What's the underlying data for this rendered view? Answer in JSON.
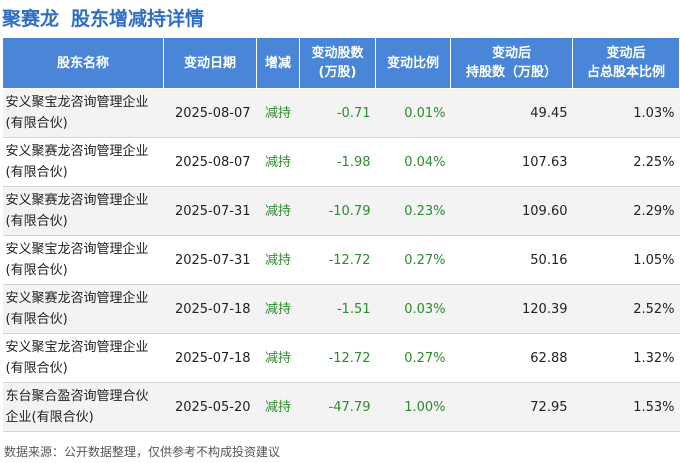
{
  "header": {
    "company": "聚赛龙",
    "title": "股东增减持详情"
  },
  "table": {
    "columns": [
      "股东名称",
      "变动日期",
      "增减",
      "变动股数\n(万股)",
      "变动比例",
      "变动后\n持股数（万股）",
      "变动后\n占总股本比例"
    ],
    "rows": [
      {
        "name": "安义聚宝龙咨询管理企业(有限合伙)",
        "date": "2025-08-07",
        "dir": "减持",
        "change": "-0.71",
        "ratio": "0.01%",
        "after": "49.45",
        "pct": "1.03%"
      },
      {
        "name": "安义聚赛龙咨询管理企业(有限合伙)",
        "date": "2025-08-07",
        "dir": "减持",
        "change": "-1.98",
        "ratio": "0.04%",
        "after": "107.63",
        "pct": "2.25%"
      },
      {
        "name": "安义聚赛龙咨询管理企业(有限合伙)",
        "date": "2025-07-31",
        "dir": "减持",
        "change": "-10.79",
        "ratio": "0.23%",
        "after": "109.60",
        "pct": "2.29%"
      },
      {
        "name": "安义聚宝龙咨询管理企业(有限合伙)",
        "date": "2025-07-31",
        "dir": "减持",
        "change": "-12.72",
        "ratio": "0.27%",
        "after": "50.16",
        "pct": "1.05%"
      },
      {
        "name": "安义聚赛龙咨询管理企业(有限合伙)",
        "date": "2025-07-18",
        "dir": "减持",
        "change": "-1.51",
        "ratio": "0.03%",
        "after": "120.39",
        "pct": "2.52%"
      },
      {
        "name": "安义聚宝龙咨询管理企业(有限合伙)",
        "date": "2025-07-18",
        "dir": "减持",
        "change": "-12.72",
        "ratio": "0.27%",
        "after": "62.88",
        "pct": "1.32%"
      },
      {
        "name": "东台聚合盈咨询管理合伙企业(有限合伙)",
        "date": "2025-05-20",
        "dir": "减持",
        "change": "-47.79",
        "ratio": "1.00%",
        "after": "72.95",
        "pct": "1.53%"
      }
    ]
  },
  "footer": {
    "source": "数据来源：公开数据整理，仅供参考不构成投资建议"
  },
  "colors": {
    "accent": "#2e6ec3",
    "header_bg": "#4a86d8",
    "decrease": "#2e8b2e"
  }
}
